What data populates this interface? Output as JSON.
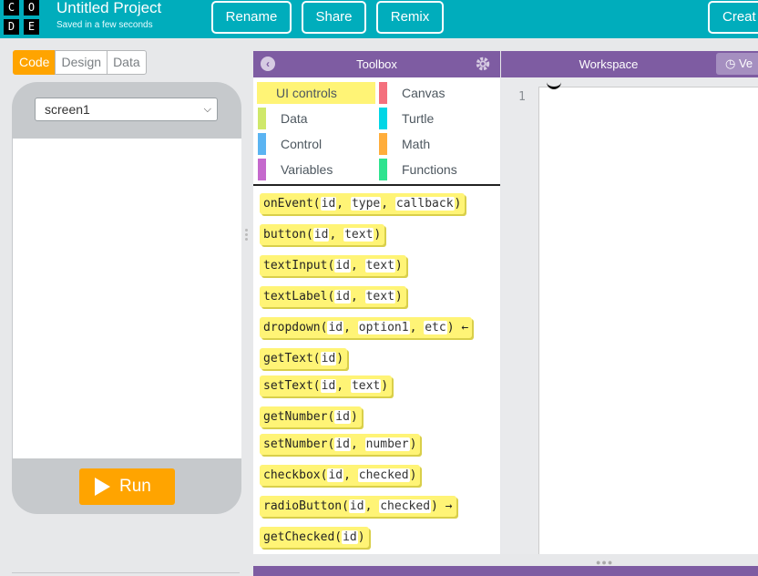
{
  "header": {
    "logo_letters": [
      "C",
      "O",
      "D",
      "E"
    ],
    "project_name": "Untitled Project",
    "saved_status": "Saved in a few seconds",
    "rename_label": "Rename",
    "share_label": "Share",
    "remix_label": "Remix",
    "create_label": "Creat"
  },
  "mode_tabs": [
    "Code",
    "Design",
    "Data"
  ],
  "active_mode": "Code",
  "app_preview": {
    "screen_select": "screen1",
    "run_label": "Run"
  },
  "toolbox": {
    "title": "Toolbox",
    "categories": [
      {
        "name": "UI controls",
        "color": "#fff476",
        "selected": true
      },
      {
        "name": "Canvas",
        "color": "#f4707d"
      },
      {
        "name": "Data",
        "color": "#cfe86a"
      },
      {
        "name": "Turtle",
        "color": "#00d6e6"
      },
      {
        "name": "Control",
        "color": "#5bb4f2"
      },
      {
        "name": "Math",
        "color": "#ffad3b"
      },
      {
        "name": "Variables",
        "color": "#c569cd"
      },
      {
        "name": "Functions",
        "color": "#2ee38f"
      }
    ],
    "blocks": [
      {
        "fn": "onEvent",
        "params": [
          "id",
          "type",
          "callback"
        ],
        "suffix": ""
      },
      {
        "fn": "button",
        "params": [
          "id",
          "text"
        ],
        "suffix": ""
      },
      {
        "fn": "textInput",
        "params": [
          "id",
          "text"
        ],
        "suffix": ""
      },
      {
        "fn": "textLabel",
        "params": [
          "id",
          "text"
        ],
        "suffix": ""
      },
      {
        "fn": "dropdown",
        "params": [
          "id",
          "option1",
          "etc"
        ],
        "suffix": " ←"
      },
      {
        "fn": "getText",
        "params": [
          "id"
        ],
        "suffix": ""
      },
      {
        "fn": "setText",
        "params": [
          "id",
          "text"
        ],
        "suffix": ""
      },
      {
        "fn": "getNumber",
        "params": [
          "id"
        ],
        "suffix": ""
      },
      {
        "fn": "setNumber",
        "params": [
          "id",
          "number"
        ],
        "suffix": ""
      },
      {
        "fn": "checkbox",
        "params": [
          "id",
          "checked"
        ],
        "suffix": ""
      },
      {
        "fn": "radioButton",
        "params": [
          "id",
          "checked"
        ],
        "suffix": " →"
      },
      {
        "fn": "getChecked",
        "params": [
          "id"
        ],
        "suffix": ""
      }
    ]
  },
  "workspace": {
    "title": "Workspace",
    "version_label": "Ve",
    "line_number": "1"
  },
  "icons": {
    "back": "chevron-left-icon",
    "settings": "gear-icon",
    "version": "clock-icon",
    "run": "play-icon"
  }
}
